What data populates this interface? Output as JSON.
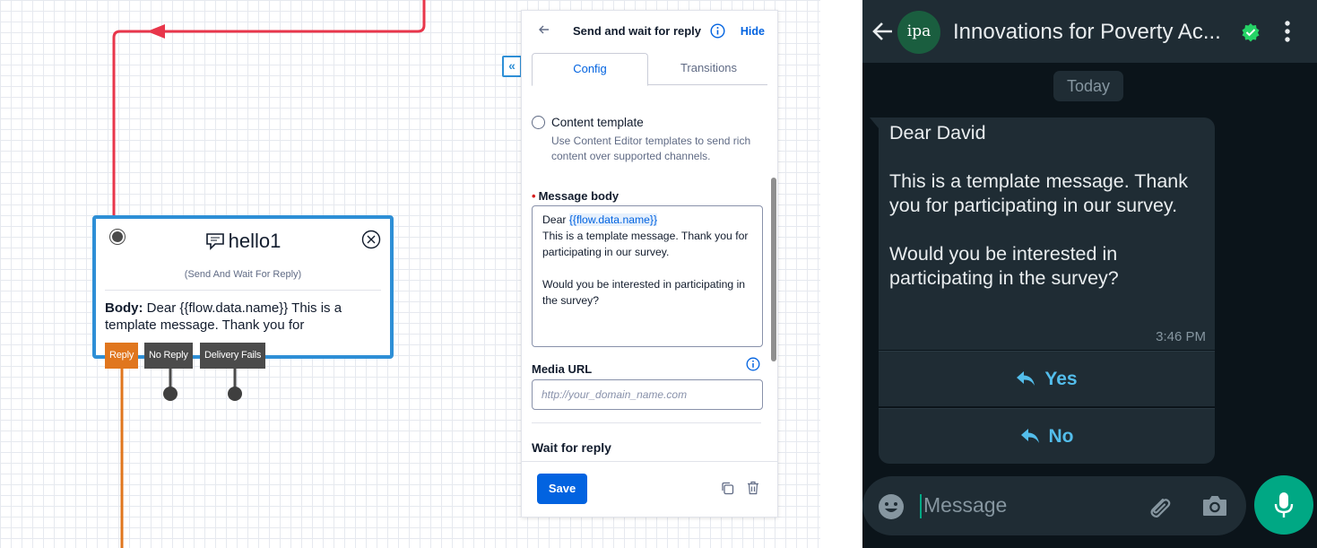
{
  "colors": {
    "accent_blue": "#0263e0",
    "widget_border": "#2e8fd6",
    "wire_red": "#e8364b",
    "wire_orange": "#e0761e",
    "whatsapp_green": "#00a884",
    "whatsapp_link": "#53bdeb"
  },
  "canvas": {
    "widget": {
      "title": "hello1",
      "subtitle": "(Send And Wait For Reply)",
      "body_label": "Body:",
      "body_text": "Dear {{flow.data.name}} This is a template message. Thank you for",
      "icon": "chat-bubble-icon",
      "close_icon": "close-circle-icon"
    },
    "transitions": [
      "Reply",
      "No Reply",
      "Delivery Fails"
    ],
    "collapse_button": "«"
  },
  "panel": {
    "back_icon": "arrow-left-icon",
    "title": "Send and wait for reply",
    "info_icon": "info-icon",
    "hide_label": "Hide",
    "tabs": [
      {
        "label": "Config",
        "active": true
      },
      {
        "label": "Transitions",
        "active": false
      }
    ],
    "content_template": {
      "title": "Content template",
      "description": "Use Content Editor templates to send rich content over supported channels."
    },
    "message_body": {
      "label": "Message body",
      "required_marker": "•",
      "prefix": "Dear ",
      "variable": "{{flow.data.name}}",
      "rest": "This is a template message. Thank you for participating in our survey.\n\nWould you be interested in participating in the survey?"
    },
    "media_url": {
      "label": "Media URL",
      "placeholder": "http://your_domain_name.com"
    },
    "wait_for_reply_label": "Wait for reply",
    "save_label": "Save",
    "copy_icon": "copy-icon",
    "trash_icon": "trash-icon"
  },
  "whatsapp": {
    "contact_name": "Innovations for Poverty Ac...",
    "avatar_text": "ipa",
    "verified_icon": "verified-badge-icon",
    "menu_icon": "more-vertical-icon",
    "date_chip": "Today",
    "message": "Dear David\n\nThis is a template message. Thank you for participating in our survey.\n\nWould you be interested in participating in the survey?",
    "time": "3:46 PM",
    "buttons": [
      "Yes",
      "No"
    ],
    "input_placeholder": "Message"
  }
}
